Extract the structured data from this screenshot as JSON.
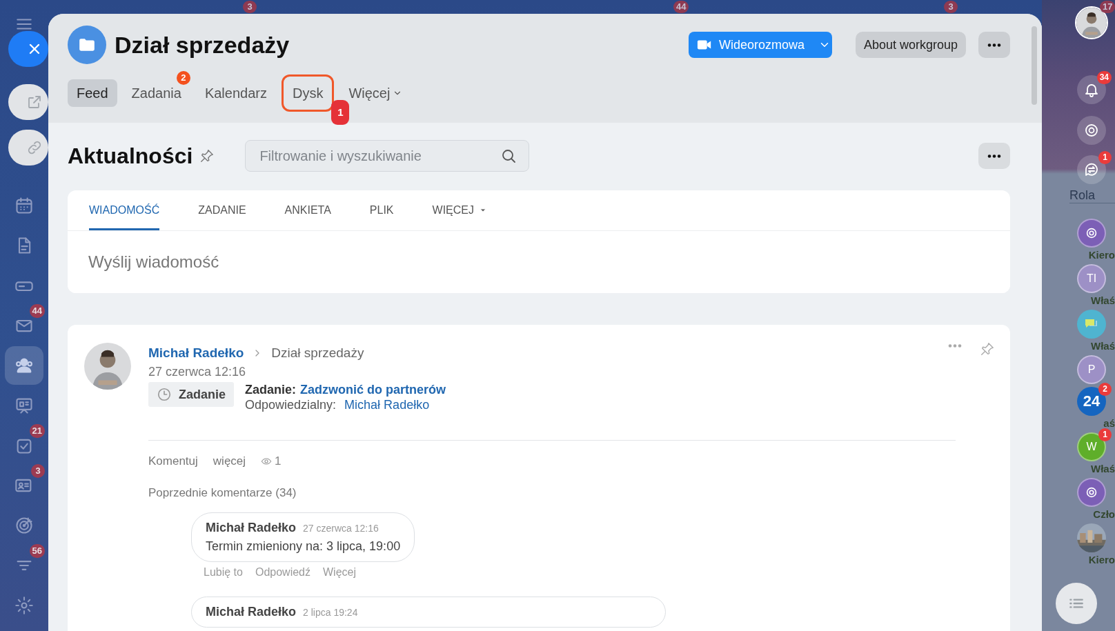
{
  "background": {
    "badges": [
      "3",
      "44",
      "3",
      "17"
    ]
  },
  "left_sidebar": {
    "items": [
      {
        "selected": false
      },
      {
        "selected": false
      },
      {
        "selected": false
      },
      {
        "selected": false,
        "badge": "44"
      },
      {
        "selected": true
      },
      {
        "selected": false
      },
      {
        "selected": false,
        "badge": "21"
      },
      {
        "selected": false,
        "badge": "3"
      },
      {
        "selected": false
      },
      {
        "selected": false,
        "badge": "56"
      },
      {
        "selected": false
      }
    ]
  },
  "header": {
    "title": "Dział sprzedaży",
    "video_button": "Wideorozmowa",
    "about_button": "About workgroup",
    "tabs": [
      {
        "label": "Feed",
        "kind": "link",
        "selected": true,
        "highlighted": false
      },
      {
        "label": "Zadania",
        "kind": "link",
        "selected": false,
        "highlighted": false,
        "badge": "2"
      },
      {
        "label": "Kalendarz",
        "kind": "link",
        "selected": false,
        "highlighted": false
      },
      {
        "label": "Dysk",
        "kind": "link",
        "selected": false,
        "highlighted": true,
        "callout": "1"
      },
      {
        "label": "Więcej",
        "kind": "menu",
        "selected": false,
        "highlighted": false
      }
    ]
  },
  "feed": {
    "title": "Aktualności",
    "search": {
      "placeholder": "Filtrowanie i wyszukiwanie"
    }
  },
  "composer": {
    "placeholder": "Wyślij wiadomość",
    "tabs": [
      {
        "label": "WIADOMOŚĆ",
        "kind": "link",
        "selected": true
      },
      {
        "label": "ZADANIE",
        "kind": "link",
        "selected": false
      },
      {
        "label": "ANKIETA",
        "kind": "link",
        "selected": false
      },
      {
        "label": "PLIK",
        "kind": "link",
        "selected": false
      },
      {
        "label": "WIĘCEJ",
        "kind": "menu",
        "selected": false
      }
    ]
  },
  "post": {
    "author": "Michał Radełko",
    "destination": "Dział sprzedaży",
    "date": "27 czerwca 12:16",
    "type_tag": "Zadanie",
    "task_label": "Zadanie:",
    "task_link": "Zadzwonić do partnerów",
    "responsible_label": "Odpowiedzialny:",
    "responsible": "Michał Radełko",
    "actions": [
      "Komentuj",
      "więcej"
    ],
    "views": "1",
    "previous_comments": "Poprzednie komentarze (34)",
    "comments": [
      {
        "author": "Michał Radełko",
        "date": "27 czerwca 12:16",
        "text": "Termin zmieniony na: 3 lipca, 19:00",
        "actions": [
          "Lubię to",
          "Odpowiedź",
          "Więcej"
        ]
      },
      {
        "author": "Michał Radełko",
        "date": "2 lipca 19:24"
      }
    ]
  },
  "right_bar": {
    "notifications": {
      "badge": "34"
    },
    "messenger": {
      "badge": "1",
      "label": "Rola"
    },
    "chats": [
      {
        "kind": "spiral",
        "tag": "Kiero"
      },
      {
        "kind": "initials",
        "initials": "TI",
        "color": "#9d90c6",
        "tag": "Właś"
      },
      {
        "kind": "bubbles",
        "tag": "Właś"
      },
      {
        "kind": "initials",
        "initials": "P",
        "color": "#9d90c6"
      },
      {
        "kind": "logo",
        "text": "24",
        "badge": "2",
        "tag": "aś"
      },
      {
        "kind": "initials",
        "initials": "W",
        "color": "#5fae2a",
        "badge": "1",
        "tag": "Właś"
      },
      {
        "kind": "spiral",
        "tag": "Czło"
      },
      {
        "kind": "picture",
        "tag": "Kiero"
      }
    ]
  }
}
